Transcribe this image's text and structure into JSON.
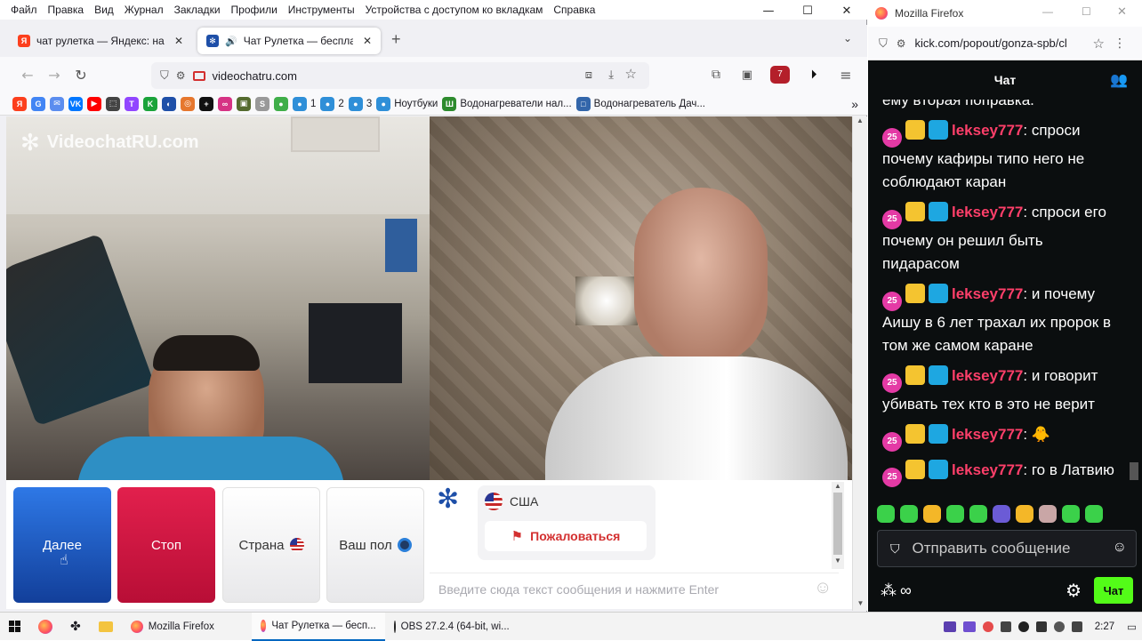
{
  "left_window": {
    "menu": [
      "Файл",
      "Правка",
      "Вид",
      "Журнал",
      "Закладки",
      "Профили",
      "Инструменты",
      "Устройства с доступом ко вкладкам",
      "Справка"
    ],
    "window_controls": {
      "minimize": "—",
      "maximize": "☐",
      "close": "✕"
    },
    "tabs": [
      {
        "title": "чат рулетка — Яндекс: нашлос",
        "favicon_letter": "Я",
        "favicon_color": "#fc3f1d"
      },
      {
        "title": "Чат Рулетка — бесплатный",
        "favicon_letter": "✻",
        "favicon_color": "#1e4fa8"
      }
    ],
    "new_tab": "+",
    "url": "videochatru.com",
    "bookmarks": [
      {
        "label": "",
        "icon_text": "Я",
        "color": "#fc3f1d"
      },
      {
        "label": "",
        "icon_text": "G",
        "color": "#4285f4"
      },
      {
        "label": "",
        "icon_text": "✉",
        "color": "#5b8def"
      },
      {
        "label": "",
        "icon_text": "VK",
        "color": "#0077ff"
      },
      {
        "label": "",
        "icon_text": "▶",
        "color": "#ff0000"
      },
      {
        "label": "",
        "icon_text": "⬚",
        "color": "#444"
      },
      {
        "label": "",
        "icon_text": "T",
        "color": "#9146ff"
      },
      {
        "label": "",
        "icon_text": "K",
        "color": "#1aa33a"
      },
      {
        "label": "",
        "icon_text": "◐",
        "color": "#1e4fa8"
      },
      {
        "label": "",
        "icon_text": "◎",
        "color": "#e6772e"
      },
      {
        "label": "",
        "icon_text": "+",
        "color": "#111"
      },
      {
        "label": "",
        "icon_text": "∞",
        "color": "#d63384"
      },
      {
        "label": "",
        "icon_text": "▣",
        "color": "#556b2f"
      },
      {
        "label": "",
        "icon_text": "S",
        "color": "#999"
      },
      {
        "label": "",
        "icon_text": "●",
        "color": "#3fae49"
      },
      {
        "label": "1",
        "icon_text": "●",
        "color": "#2f8fd8"
      },
      {
        "label": "2",
        "icon_text": "●",
        "color": "#2f8fd8"
      },
      {
        "label": "3",
        "icon_text": "●",
        "color": "#2f8fd8"
      },
      {
        "label": "Ноутбуки",
        "icon_text": "●",
        "color": "#2f8fd8"
      },
      {
        "label": "Водонагреватели нал...",
        "icon_text": "Ш",
        "color": "#2e8b2e"
      },
      {
        "label": "Водонагреватель Дач...",
        "icon_text": "□",
        "color": "#3366aa"
      }
    ],
    "more": "»",
    "site_logo": "VideochatRU.com",
    "buttons": {
      "next": "Далее",
      "stop": "Стоп",
      "country": "Страна",
      "gender": "Ваш пол"
    },
    "colors": {
      "next": "#1d5fcf",
      "stop": "#d0123f"
    },
    "partner_country": "США",
    "report": "Пожаловаться",
    "message_placeholder": "Введите сюда текст сообщения и нажмите Enter"
  },
  "right_window": {
    "title": "Mozilla Firefox",
    "url": "kick.com/popout/gonza-spb/cl",
    "chat_header": "Чат",
    "partial_top": "ему вторая поправка.",
    "messages": [
      {
        "badge": "25",
        "user": "leksey777",
        "text": "спроси почему кафиры типо него не соблюдают каран"
      },
      {
        "badge": "25",
        "user": "leksey777",
        "text": "спроси его почему он решил быть пидарасом"
      },
      {
        "badge": "25",
        "user": "leksey777",
        "text": "и почему Аишу в 6 лет трахал их пророк в том же самом каране"
      },
      {
        "badge": "25",
        "user": "leksey777",
        "text": "и говорит убивать тех кто в это не верит"
      },
      {
        "badge": "25",
        "user": "leksey777",
        "text": "🐥"
      },
      {
        "badge": "25",
        "user": "leksey777",
        "text": "го в Латвию"
      }
    ],
    "input_placeholder": "Отправить сообщение",
    "send": "Чат",
    "accent": "#53fc18",
    "user_color": "#ff3f6a"
  },
  "taskbar": {
    "items": [
      "Mozilla Firefox",
      "Чат Рулетка — бесп...",
      "OBS 27.2.4 (64-bit, wi..."
    ],
    "clock": "2:27"
  }
}
